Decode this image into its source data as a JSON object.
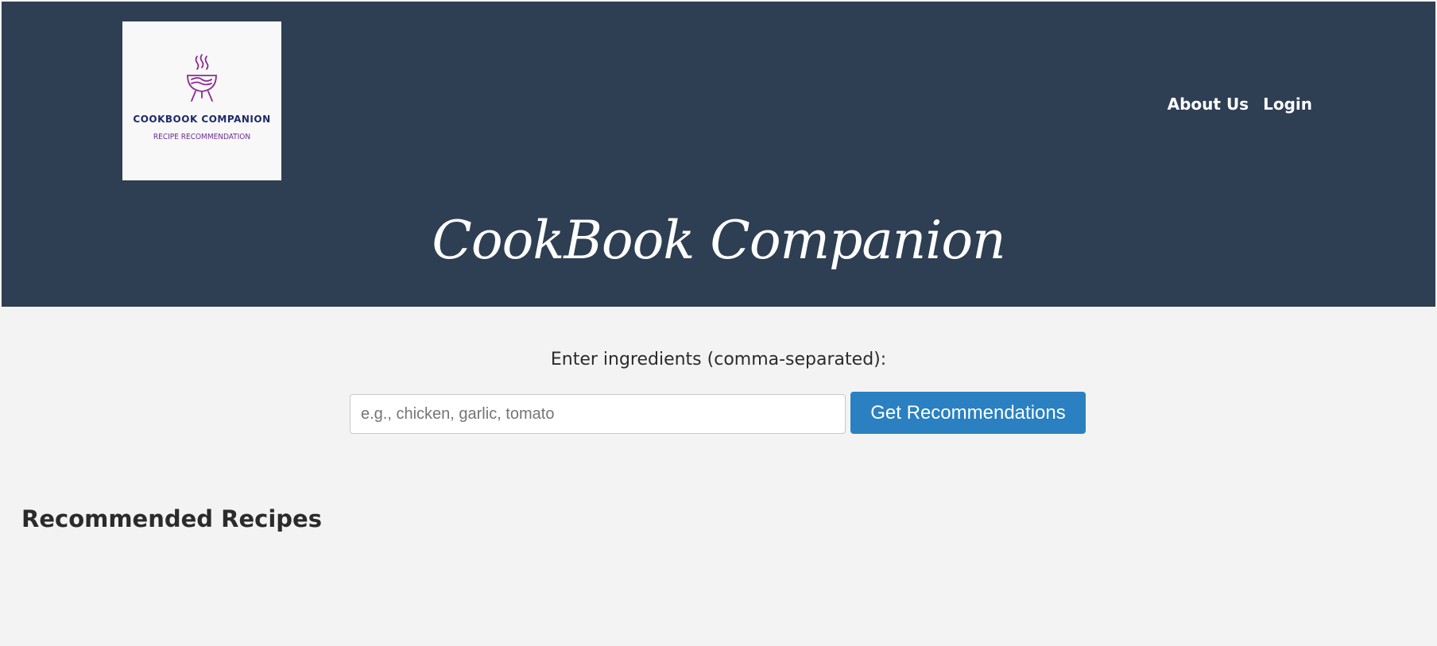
{
  "logo": {
    "icon": "grill-pot-icon",
    "title": "COOKBOOK COMPANION",
    "subtitle": "RECIPE RECOMMENDATION"
  },
  "nav": {
    "about": "About Us",
    "login": "Login"
  },
  "header": {
    "site_title": "CookBook Companion"
  },
  "search": {
    "label": "Enter ingredients (comma-separated):",
    "placeholder": "e.g., chicken, garlic, tomato",
    "value": "",
    "button_label": "Get Recommendations"
  },
  "results": {
    "heading": "Recommended Recipes"
  },
  "colors": {
    "header_bg": "#2e3e53",
    "page_bg": "#f3f3f3",
    "button_bg": "#2a80c0",
    "logo_purple": "#8e2a8f",
    "logo_navy": "#1d2a6b"
  }
}
